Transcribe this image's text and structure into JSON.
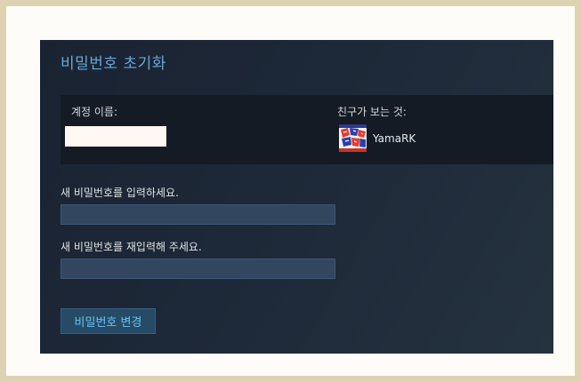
{
  "page": {
    "title": "비밀번호 초기화"
  },
  "account": {
    "label": "계정 이름:",
    "value": ""
  },
  "friends_view": {
    "label": "친구가 보는 것:",
    "persona_name": "YamaRK",
    "avatar_icon": "avatar-image"
  },
  "form": {
    "new_password_label": "새 비밀번호를 입력하세요.",
    "new_password_value": "",
    "confirm_password_label": "새 비밀번호를 재입력해 주세요.",
    "confirm_password_value": "",
    "submit_label": "비밀번호 변경"
  },
  "colors": {
    "accent": "#67c1f5",
    "title": "#67a8d7",
    "panel_background": "#1b2838",
    "input_background": "#32465f",
    "button_background": "#274b66"
  }
}
